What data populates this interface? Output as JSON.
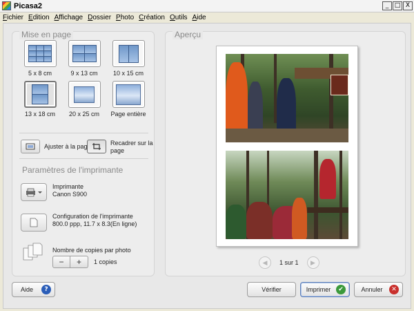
{
  "window": {
    "title": "Picasa2",
    "controls": {
      "minimize": "_",
      "maximize": "□",
      "close": "X"
    }
  },
  "menu": [
    {
      "underline": "F",
      "rest": "ichier"
    },
    {
      "underline": "E",
      "rest": "dition"
    },
    {
      "underline": "A",
      "rest": "ffichage"
    },
    {
      "underline": "D",
      "rest": "ossier"
    },
    {
      "underline": "P",
      "rest": "hoto"
    },
    {
      "underline": "C",
      "rest": "réation"
    },
    {
      "underline": "O",
      "rest": "utils"
    },
    {
      "underline": "A",
      "rest": "ide"
    }
  ],
  "layout": {
    "title": "Mise en page",
    "options": [
      {
        "label": "5 x 8 cm",
        "rows": 3,
        "cols": 3,
        "selected": false
      },
      {
        "label": "9 x 13 cm",
        "rows": 2,
        "cols": 2,
        "selected": false
      },
      {
        "label": "10 x 15 cm",
        "rows": 1,
        "cols": 2,
        "selected": false
      },
      {
        "label": "13 x 18 cm",
        "rows": 2,
        "cols": 1,
        "selected": true
      },
      {
        "label": "20 x 25 cm",
        "rows": 1,
        "cols": 1,
        "selected": false
      },
      {
        "label": "Page entière",
        "rows": 1,
        "cols": 1,
        "selected": false
      }
    ],
    "fit_label": "Ajuster à la page",
    "crop_label": "Recadrer sur la page"
  },
  "printer": {
    "title": "Paramètres de l'imprimante",
    "printer_label": "Imprimante",
    "printer_name": "Canon S900",
    "config_label": "Configuration de l'imprimante",
    "config_value": "800.0 ppp, 11.7 x 8.3(En ligne)",
    "copies_label": "Nombre de copies par photo",
    "minus": "−",
    "plus": "+",
    "copies_value": "1 copies"
  },
  "preview": {
    "title": "Aperçu",
    "page_indicator": "1 sur 1",
    "prev": "◀",
    "next": "▶"
  },
  "footer": {
    "help": "Aide",
    "help_icon": "?",
    "verify": "Vérifier",
    "print": "Imprimer",
    "print_icon": "✔",
    "cancel": "Annuler",
    "cancel_icon": "✕"
  },
  "colors": {
    "help_blue": "#2a5db8",
    "ok_green": "#3b9a3b",
    "cancel_red": "#c9302c"
  }
}
